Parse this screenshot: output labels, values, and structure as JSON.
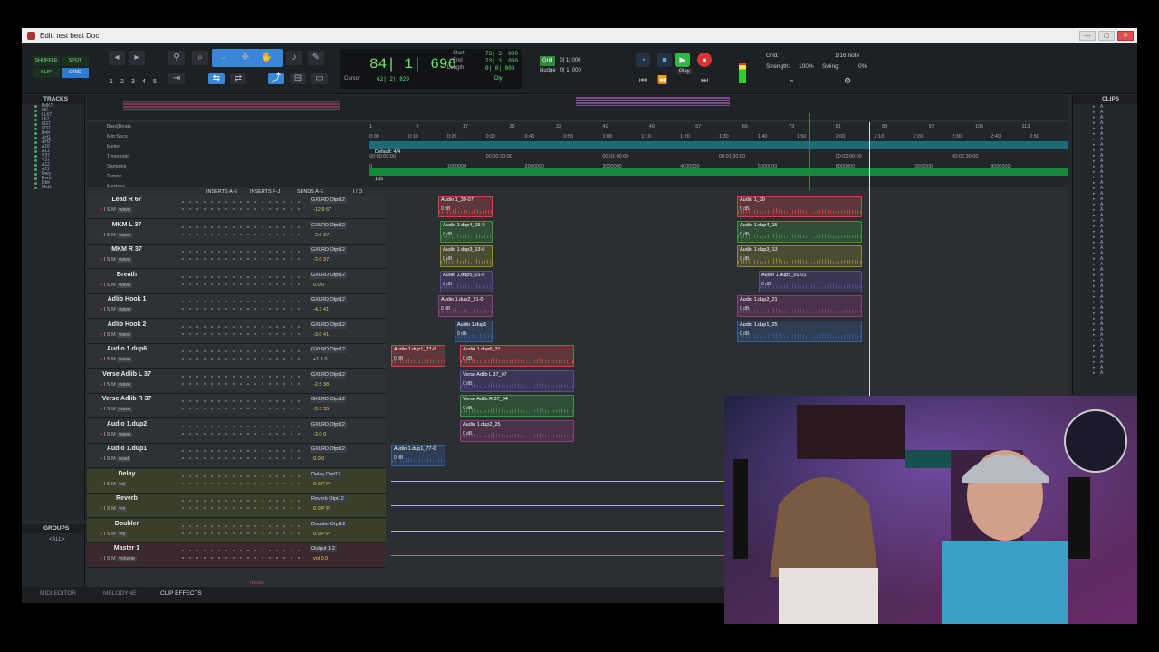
{
  "window": {
    "title": "Edit: test beat Doc",
    "min": "—",
    "max": "▢",
    "close": "✕"
  },
  "toolbar": {
    "modes": [
      "SHUFFLE",
      "SPOT",
      "SLIP",
      "GRID"
    ],
    "number_buttons": [
      "1",
      "2",
      "3",
      "4",
      "5"
    ],
    "counter": {
      "main": "84| 1| 696",
      "cursor_label": "Cursor",
      "cursor_value": "62| 2| 829",
      "start_label": "Start",
      "end_label": "End",
      "length_label": "Length",
      "start_value": "73| 3| 000",
      "end_value": "73| 3| 000",
      "length_value": "0| 0| 000",
      "dly_label": "Dly"
    },
    "grid_label": "Grid",
    "grid_value": "0| 1| 000",
    "nudge_label": "Nudge",
    "nudge_value": "0| 1| 000",
    "play_tooltip": "Play",
    "settings": {
      "grid": "Grid:",
      "grid_note": "1/16 note",
      "strength": "Strength:",
      "strength_value": "100%",
      "swing": "Swing:",
      "swing_value": "0%"
    }
  },
  "tracks_panel": {
    "title": "TRACKS",
    "items": [
      "BdKT",
      "MK",
      "LL67",
      "L67",
      "M37",
      "M37",
      "Brth",
      "AH1",
      "AH2",
      "A16",
      "A11",
      "V37",
      "V37",
      "A12",
      "A11",
      "Dely",
      "Rvrb",
      "Dblr",
      "Mst1"
    ]
  },
  "groups_panel": {
    "title": "GROUPS",
    "all": "<ALL>"
  },
  "rulers": {
    "labels": [
      "Bars|Beats",
      "Min:Secs",
      "Meter",
      "Timecode",
      "Samples",
      "Tempo",
      "Markers"
    ],
    "bars": [
      "1",
      "9",
      "17",
      "25",
      "33",
      "41",
      "49",
      "57",
      "65",
      "73",
      "81",
      "89",
      "97",
      "105",
      "113"
    ],
    "minsecs": [
      "0:00",
      "0:10",
      "0:20",
      "0:30",
      "0:40",
      "0:50",
      "1:00",
      "1:10",
      "1:20",
      "1:30",
      "1:40",
      "1:50",
      "2:00",
      "2:10",
      "2:20",
      "2:30",
      "2:40",
      "2:50"
    ],
    "meter": "Default: 4/4",
    "timecode": [
      "00:00:00:00",
      "00:00:30:00",
      "00:01:00:00",
      "00:01:30:00",
      "00:02:00:00",
      "00:02:30:00"
    ],
    "samples": [
      "0",
      "1000000",
      "2000000",
      "3000000",
      "4000000",
      "5000000",
      "6000000",
      "7000000",
      "8000000"
    ],
    "tempo": "165"
  },
  "column_headers": {
    "inserts_ae": "INSERTS A-E",
    "inserts_fj": "INSERTS F-J",
    "sends_ae": "SENDS A-E",
    "io": "I / O"
  },
  "tracks": [
    {
      "name": "Lead R 67",
      "io": "GXLRD Otpt12",
      "vol": "-12.9  67",
      "mode": "wave"
    },
    {
      "name": "MKM L 37",
      "io": "GXLRD Otpt12",
      "vol": "-2.0  37",
      "mode": "wave"
    },
    {
      "name": "MKM R 37",
      "io": "GXLRD Otpt12",
      "vol": "-2.0  37",
      "mode": "wave"
    },
    {
      "name": "Breath",
      "io": "GXLRD Otpt12",
      "vol": "0.0  0",
      "mode": "wave"
    },
    {
      "name": "Adlib Hook 1",
      "io": "GXLRD Otpt12",
      "vol": "-4.3  41",
      "mode": "wave"
    },
    {
      "name": "Adlib Hook 2",
      "io": "GXLRD Otpt12",
      "vol": "-3.0  41",
      "mode": "wave"
    },
    {
      "name": "Audio 1.dup6",
      "io": "GXLRD Otpt12",
      "vol": "+1.1  0",
      "mode": "wave"
    },
    {
      "name": "Verse Adlib L 37",
      "io": "GXLRD Otpt12",
      "vol": "-2.5  38",
      "mode": "wave"
    },
    {
      "name": "Verse Adlib R 37",
      "io": "GXLRD Otpt12",
      "vol": "-3.3  35",
      "mode": "wave"
    },
    {
      "name": "Audio 1.dup2",
      "io": "GXLRD Otpt12",
      "vol": "-3.0  0",
      "mode": "wave"
    },
    {
      "name": "Audio 1.dup1",
      "io": "GXLRD Otpt12",
      "vol": "0.0  0",
      "mode": "read"
    },
    {
      "name": "Delay",
      "io": "Delay Otpt12",
      "vol": "0.0  P  P",
      "mode": "vol"
    },
    {
      "name": "Reverb",
      "io": "Reverb Otpt12",
      "vol": "0.0  P  P",
      "mode": "vol"
    },
    {
      "name": "Doubler",
      "io": "Doubler Otpt12",
      "vol": "0.0  P  P",
      "mode": "vol"
    },
    {
      "name": "Master 1",
      "io": "Output 1-2",
      "vol": "vol  0.0",
      "mode": "volume"
    }
  ],
  "clips": [
    {
      "name": "Audio 1_39-07",
      "gain": "0 dB"
    },
    {
      "name": "Audio 1_39",
      "gain": "0 dB"
    },
    {
      "name": "Audio 1.dup4_15-0",
      "gain": "0 dB"
    },
    {
      "name": "Audio 1.dup4_15",
      "gain": "0 dB"
    },
    {
      "name": "Audio 1.dup3_13-0",
      "gain": "0 dB"
    },
    {
      "name": "Audio 1.dup3_13",
      "gain": "0 dB"
    },
    {
      "name": "Audio 1.dup5_01-0",
      "gain": "0 dB"
    },
    {
      "name": "Audio 1.dup5_01-01",
      "gain": "0 dB"
    },
    {
      "name": "Audio 1.dup2_21-0",
      "gain": "0 dB"
    },
    {
      "name": "Audio 1.dup2_21",
      "gain": "0 dB"
    },
    {
      "name": "Audio 1.dup1",
      "gain": "0 dB"
    },
    {
      "name": "Audio 1.dup1_25",
      "gain": "0 dB"
    },
    {
      "name": "Audio 1.dup1_77-0",
      "gain": "0 dB"
    },
    {
      "name": "Audio 1.dup6_21",
      "gain": "0 dB"
    },
    {
      "name": "Verse Adlib L 37_07",
      "gain": "0 dB"
    },
    {
      "name": "Verse Adlib R 37_04",
      "gain": "0 dB"
    },
    {
      "name": "Audio 1.dup2_25",
      "gain": "0 dB"
    },
    {
      "name": "Audio 1.dup1_77-0",
      "gain": "0 dB"
    }
  ],
  "clips_panel": {
    "title": "CLIPS",
    "items": [
      "A",
      "A",
      "A",
      "A",
      "A",
      "A",
      "A",
      "A",
      "A",
      "A",
      "A",
      "A",
      "A",
      "A",
      "A",
      "A",
      "A",
      "A",
      "A",
      "A",
      "A",
      "A",
      "A",
      "A",
      "A",
      "A",
      "A",
      "A",
      "A",
      "A",
      "A",
      "A",
      "A",
      "A",
      "A",
      "A",
      "A",
      "A",
      "A",
      "A",
      "A",
      "A",
      "A",
      "A",
      "A",
      "A",
      "A",
      "A",
      "A",
      "A"
    ]
  },
  "bottom_tabs": [
    "MIDI EDITOR",
    "MELODYNE",
    "CLIP EFFECTS"
  ],
  "record_label": "record",
  "colors": {
    "accent": "#3a86d8",
    "counter_green": "#6ee36e",
    "red": "#c94848",
    "green": "#3f8f45",
    "olive": "#8e8a35",
    "purple": "#5a4a9a",
    "magenta": "#8a4078",
    "blue": "#3a5f9a"
  }
}
